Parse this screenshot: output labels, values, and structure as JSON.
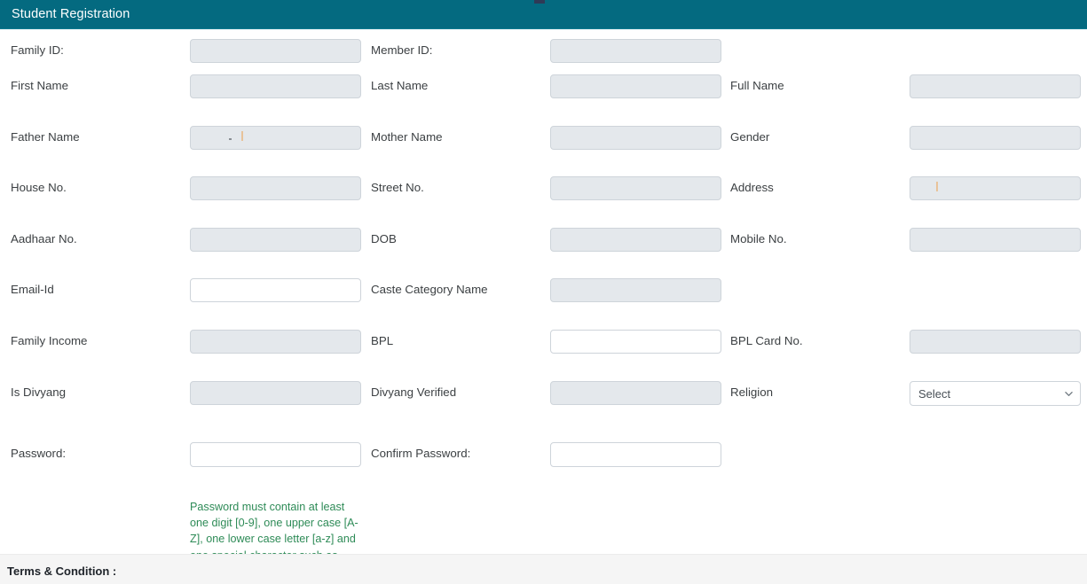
{
  "header": {
    "title": "Student Registration",
    "bar_color": "#046a80",
    "text_color": "#ffffff"
  },
  "colors": {
    "accent": "#046a80",
    "field_disabled_bg": "#e4e8ec",
    "field_border": "#ced4da",
    "hint_green": "#2e8b57",
    "footer_bg": "#f5f5f5",
    "label_text": "#3c4043"
  },
  "form": {
    "rows": [
      {
        "c1": {
          "label": "Family ID:",
          "field": {
            "value": "",
            "state": "disabled"
          }
        },
        "c3": {
          "label": "Member ID:",
          "field": {
            "value": "",
            "state": "disabled"
          }
        },
        "c5": {
          "label": "",
          "field": null
        }
      },
      {
        "c1": {
          "label": "First Name",
          "field": {
            "value": "",
            "state": "disabled"
          }
        },
        "c3": {
          "label": "Last Name",
          "field": {
            "value": "",
            "state": "disabled"
          }
        },
        "c5": {
          "label": "Full Name",
          "field": {
            "value": "",
            "state": "disabled"
          }
        }
      },
      {
        "c1": {
          "label": "Father Name",
          "field": {
            "value": "",
            "state": "disabled"
          }
        },
        "c3": {
          "label": "Mother Name",
          "field": {
            "value": "",
            "state": "disabled"
          }
        },
        "c5": {
          "label": "Gender",
          "field": {
            "value": "",
            "state": "disabled"
          }
        }
      },
      {
        "c1": {
          "label": "House No.",
          "field": {
            "value": "",
            "state": "disabled"
          }
        },
        "c3": {
          "label": "Street No.",
          "field": {
            "value": "",
            "state": "disabled"
          }
        },
        "c5": {
          "label": "Address",
          "field": {
            "value": "",
            "state": "disabled"
          }
        }
      },
      {
        "c1": {
          "label": "Aadhaar No.",
          "field": {
            "value": "",
            "state": "disabled"
          }
        },
        "c3": {
          "label": "DOB",
          "field": {
            "value": "",
            "state": "disabled"
          }
        },
        "c5": {
          "label": "Mobile No.",
          "field": {
            "value": "",
            "state": "disabled"
          }
        }
      },
      {
        "c1": {
          "label": "Email-Id",
          "field": {
            "value": "",
            "state": "editable"
          }
        },
        "c3": {
          "label": "Caste Category Name",
          "field": {
            "value": "",
            "state": "disabled"
          }
        },
        "c5": {
          "label": "",
          "field": null
        }
      },
      {
        "c1": {
          "label": "Family Income",
          "field": {
            "value": "",
            "state": "disabled"
          }
        },
        "c3": {
          "label": "BPL",
          "field": {
            "value": "",
            "state": "editable"
          }
        },
        "c5": {
          "label": "BPL Card No.",
          "field": {
            "value": "",
            "state": "disabled"
          }
        }
      },
      {
        "c1": {
          "label": "Is Divyang",
          "field": {
            "value": "",
            "state": "disabled"
          }
        },
        "c3": {
          "label": "Divyang Verified",
          "field": {
            "value": "",
            "state": "disabled"
          }
        },
        "c5": {
          "label": "Religion",
          "field": {
            "value": "",
            "state": "select"
          }
        }
      },
      {
        "c1": {
          "label": "Password:",
          "field": {
            "value": "",
            "state": "editable"
          }
        },
        "c3": {
          "label": "Confirm Password:",
          "field": {
            "value": "",
            "state": "editable"
          }
        },
        "c5": {
          "label": "",
          "field": null
        }
      }
    ],
    "religion_select": {
      "selected": "Select",
      "options": [
        "Select"
      ],
      "icon": "chevron-down-icon"
    },
    "password_hint": "Password must contain at least one digit [0-9], one upper case [A-Z], one lower case letter [a-z] and one special character such as [@#&*$!]"
  },
  "footer": {
    "title": "Terms & Condition :",
    "body": ""
  }
}
